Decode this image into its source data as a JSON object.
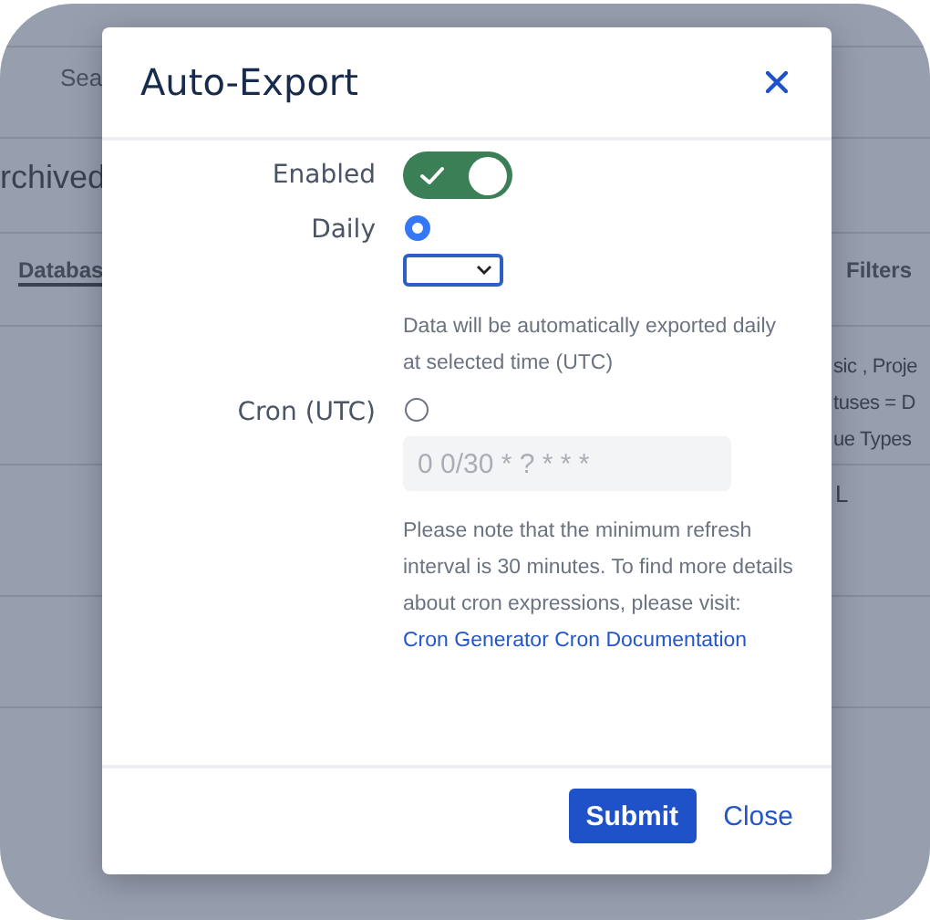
{
  "background": {
    "search_label": "Sea",
    "heading": "rchived",
    "columns": [
      {
        "label": "Databas",
        "selected": true
      },
      {
        "label": "Filters",
        "selected": false
      }
    ],
    "rows": [
      {
        "lines": [
          "sic , Proje",
          "tuses = D",
          "ue Types"
        ]
      },
      {
        "lines": [
          "L"
        ]
      }
    ]
  },
  "dialog": {
    "title": "Auto-Export",
    "enabled": {
      "label": "Enabled",
      "on": true
    },
    "options": [
      {
        "kind": "select",
        "label": "Daily",
        "selected": true,
        "help": "Data will be automatically exported daily at selected time (UTC)"
      },
      {
        "kind": "text",
        "label": "Cron (UTC)",
        "selected": false,
        "placeholder": "0 0/30 * ? * * *",
        "help": "Please note that the minimum refresh interval is 30 minutes. To find more details about cron expressions, please visit:",
        "links": [
          "Cron Generator",
          "Cron Documentation"
        ]
      }
    ],
    "buttons": [
      {
        "kind": "primary",
        "label": "Submit"
      },
      {
        "kind": "link",
        "label": "Close"
      }
    ]
  }
}
